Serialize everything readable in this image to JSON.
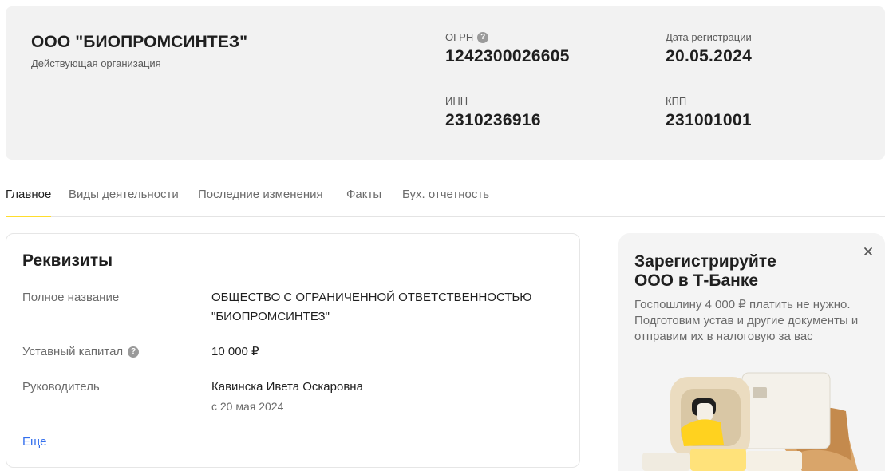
{
  "company": {
    "name": "ООО \"БИОПРОМСИНТЕЗ\"",
    "status": "Действующая организация"
  },
  "fields": {
    "ogrn": {
      "label": "ОГРН",
      "value": "1242300026605"
    },
    "reg_date": {
      "label": "Дата регистрации",
      "value": "20.05.2024"
    },
    "inn": {
      "label": "ИНН",
      "value": "2310236916"
    },
    "kpp": {
      "label": "КПП",
      "value": "231001001"
    }
  },
  "tabs": [
    {
      "label": "Главное",
      "active": true
    },
    {
      "label": "Виды деятельности"
    },
    {
      "label": "Последние изменения"
    },
    {
      "label": "Факты"
    },
    {
      "label": "Бух. отчетность"
    }
  ],
  "requisites": {
    "title": "Реквизиты",
    "full_name_label": "Полное название",
    "full_name_line1": "ОБЩЕСТВО С ОГРАНИЧЕННОЙ ОТВЕТСТВЕННОСТЬЮ",
    "full_name_line2": "\"БИОПРОМСИНТЕЗ\"",
    "capital_label": "Уставный капитал",
    "capital_value": "10 000 ₽",
    "director_label": "Руководитель",
    "director_name": "Кавинска Ивета Оскаровна",
    "director_since": "с 20 мая 2024",
    "more_link": "Еще"
  },
  "promo": {
    "title_line1": "Зарегистрируйте",
    "title_line2": "ООО в Т-Банке",
    "text_line1": "Госпошлину 4 000 ₽ платить не нужно.",
    "text_line2": "Подготовим устав и другие документы и",
    "text_line3": "отправим их в налоговую за вас"
  },
  "icons": {
    "help": "question-circle-icon",
    "close": "close-icon"
  },
  "colors": {
    "accent_yellow": "#ffdd2d",
    "link_blue": "#336fee"
  }
}
